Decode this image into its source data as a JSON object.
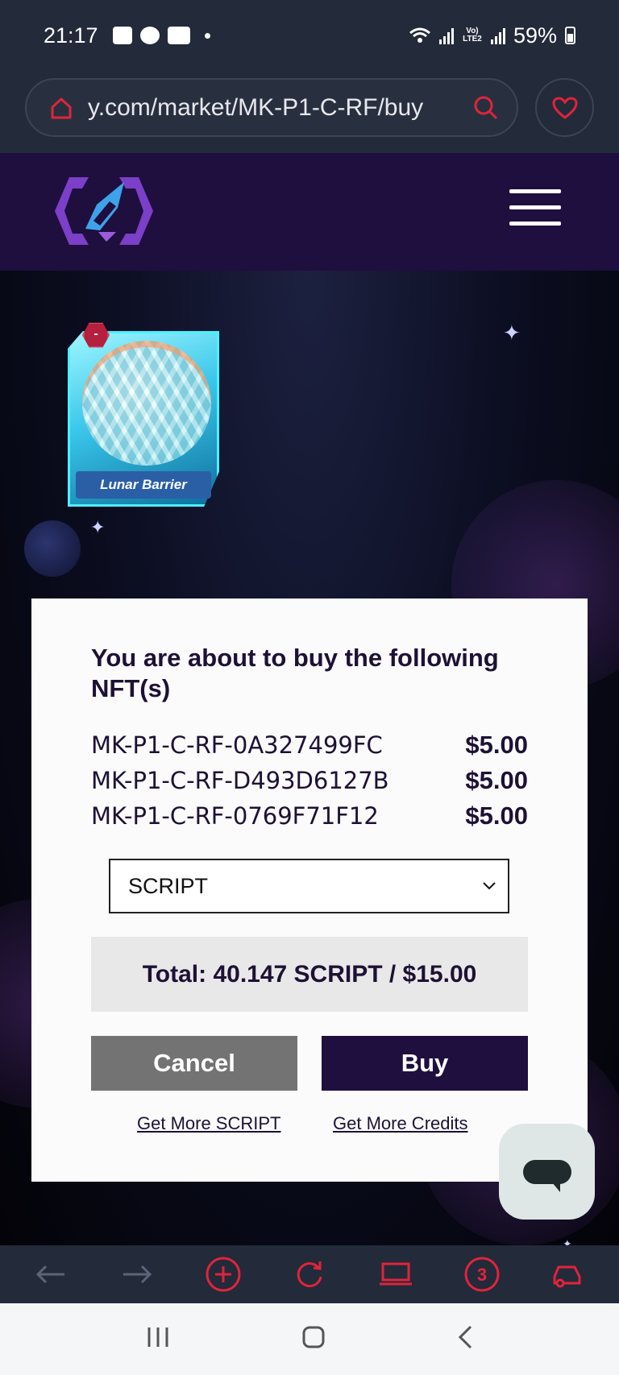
{
  "status_bar": {
    "time": "21:17",
    "notification_icons": [
      "gallery-icon",
      "facebook-icon",
      "youtube-icon"
    ],
    "battery": "59%",
    "network_label": "Vo) LTE2"
  },
  "browser": {
    "url": "y.com/market/MK-P1-C-RF/buy",
    "tab_count": "3",
    "accent_color": "#e0243b"
  },
  "card": {
    "name": "Lunar Barrier",
    "badge": "-"
  },
  "modal": {
    "title": "You are about to buy the following NFT(s)",
    "items": [
      {
        "id": "MK-P1-C-RF-0A327499FC",
        "price": "$5.00"
      },
      {
        "id": "MK-P1-C-RF-D493D6127B",
        "price": "$5.00"
      },
      {
        "id": "MK-P1-C-RF-0769F71F12",
        "price": "$5.00"
      }
    ],
    "currency_selected": "SCRIPT",
    "total": "Total: 40.147 SCRIPT / $15.00",
    "cancel_label": "Cancel",
    "buy_label": "Buy",
    "link_script": "Get More SCRIPT",
    "link_credits": "Get More Credits"
  },
  "colors": {
    "header_bg": "#1e0f3f",
    "buy_button": "#1e0f3f",
    "cancel_button": "#737373",
    "total_bg": "#e8e8e8"
  }
}
